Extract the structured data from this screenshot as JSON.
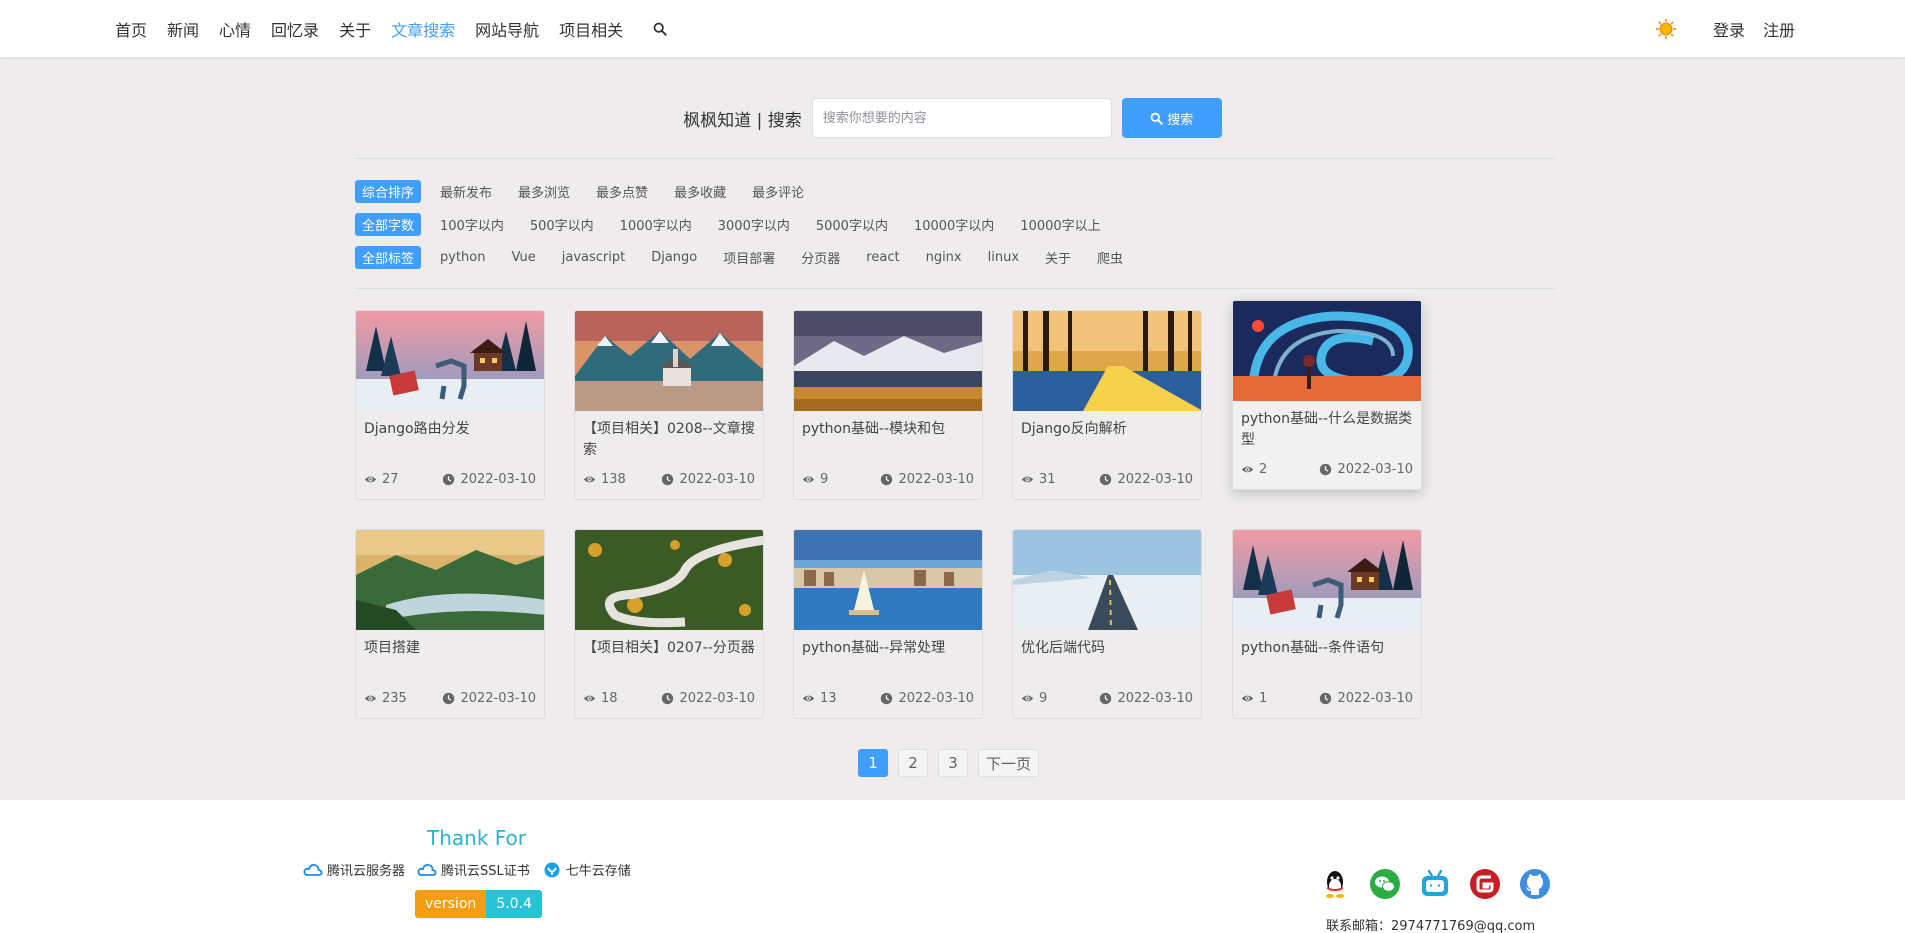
{
  "nav": {
    "items": [
      {
        "label": "首页",
        "active": false
      },
      {
        "label": "新闻",
        "active": false
      },
      {
        "label": "心情",
        "active": false
      },
      {
        "label": "回忆录",
        "active": false
      },
      {
        "label": "关于",
        "active": false
      },
      {
        "label": "文章搜索",
        "active": true
      },
      {
        "label": "网站导航",
        "active": false
      },
      {
        "label": "项目相关",
        "active": false
      }
    ],
    "search_icon": "search-icon",
    "theme_icon": "sun-icon",
    "login": "登录",
    "register": "注册"
  },
  "search": {
    "label": "枫枫知道 | 搜索",
    "placeholder": "搜索你想要的内容",
    "button": "搜索"
  },
  "filters": {
    "sort": [
      "综合排序",
      "最新发布",
      "最多浏览",
      "最多点赞",
      "最多收藏",
      "最多评论"
    ],
    "wordcount": [
      "全部字数",
      "100字以内",
      "500字以内",
      "1000字以内",
      "3000字以内",
      "5000字以内",
      "10000字以内",
      "10000字以上"
    ],
    "tags": [
      "全部标签",
      "python",
      "Vue",
      "javascript",
      "Django",
      "项目部署",
      "分页器",
      "react",
      "nginx",
      "linux",
      "关于",
      "爬虫"
    ]
  },
  "articles": [
    {
      "title": "Django路由分发",
      "views": "27",
      "date": "2022-03-10",
      "scene": "winter-deer"
    },
    {
      "title": "【项目相关】0208--文章搜索",
      "views": "138",
      "date": "2022-03-10",
      "scene": "mountain-chapel"
    },
    {
      "title": "python基础--模块和包",
      "views": "9",
      "date": "2022-03-10",
      "scene": "snowy-plain"
    },
    {
      "title": "Django反向解析",
      "views": "31",
      "date": "2022-03-10",
      "scene": "forest-road"
    },
    {
      "title": "python基础--什么是数据类型",
      "views": "2",
      "date": "2022-03-10",
      "scene": "swirl-sky"
    },
    {
      "title": "项目搭建",
      "views": "235",
      "date": "2022-03-10",
      "scene": "valley-mist"
    },
    {
      "title": "【项目相关】0207--分页器",
      "views": "18",
      "date": "2022-03-10",
      "scene": "winding-road"
    },
    {
      "title": "python基础--异常处理",
      "views": "13",
      "date": "2022-03-10",
      "scene": "harbor-sail"
    },
    {
      "title": "优化后端代码",
      "views": "9",
      "date": "2022-03-10",
      "scene": "straight-road"
    },
    {
      "title": "python基础--条件语句",
      "views": "1",
      "date": "2022-03-10",
      "scene": "winter-deer"
    }
  ],
  "pagination": {
    "pages": [
      "1",
      "2",
      "3"
    ],
    "current": "1",
    "next": "下一页"
  },
  "footer": {
    "thanks": "Thank For",
    "sponsors": [
      "腾讯云服务器",
      "腾讯云SSL证书",
      "七牛云存储"
    ],
    "version_label": "version",
    "version_value": "5.0.4",
    "social_icons": [
      "qq-icon",
      "wechat-icon",
      "bilibili-icon",
      "gitee-icon",
      "github-icon"
    ],
    "contact": "联系邮箱：2974771769@qq.com"
  },
  "colors": {
    "accent": "#409eff",
    "thanks": "#2bb3c8",
    "version_label_bg": "#f49c12",
    "version_value_bg": "#27c3d7"
  }
}
